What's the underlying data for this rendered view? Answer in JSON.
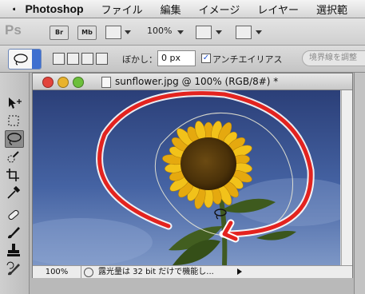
{
  "menubar": {
    "app_name": "Photoshop",
    "items": [
      "ファイル",
      "編集",
      "イメージ",
      "レイヤー",
      "選択範"
    ]
  },
  "appbar": {
    "logo": "Ps",
    "bridge_label": "Br",
    "minibridge_label": "Mb",
    "zoom": "100%"
  },
  "options": {
    "feather_label": "ぼかし：",
    "feather_value": "0 px",
    "antialias_label": "アンチエイリアス",
    "antialias_checked": "✓",
    "refine_edge": "境界線を調整"
  },
  "document": {
    "title": "sunflower.jpg @ 100% (RGB/8#) *",
    "zoom": "100%",
    "status": "露光量は 32 bit だけで機能し..."
  },
  "colors": {
    "accent": "#3e6fd0",
    "close_light": "#e2443c",
    "minimize_light": "#e9b32d",
    "zoom_light": "#6cbf3b",
    "annotation": "#e3231f"
  },
  "icons": {
    "menu": "apple-icon",
    "tools": [
      "move-icon",
      "marquee-icon",
      "lasso-icon",
      "quick-select-icon",
      "crop-icon",
      "eyedropper-icon",
      "healing-brush-icon",
      "brush-icon",
      "stamp-icon",
      "history-brush-icon"
    ]
  }
}
